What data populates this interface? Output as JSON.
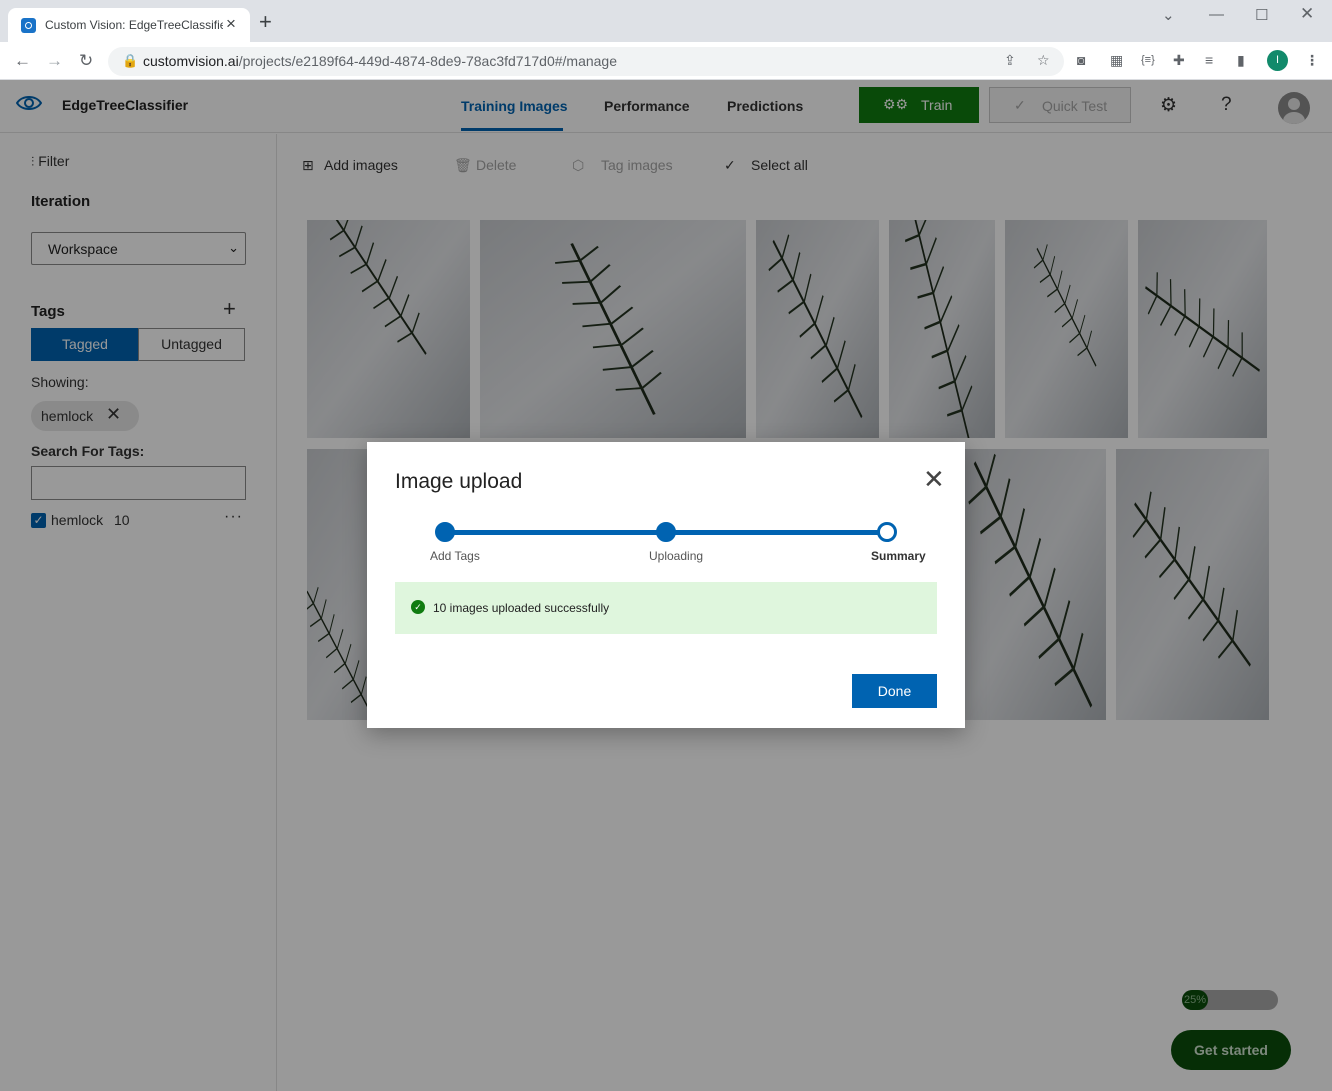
{
  "browser": {
    "tab_title": "Custom Vision: EdgeTreeClassifier",
    "url_host": "customvision.ai",
    "url_path": "/projects/e2189f64-449d-4874-8de9-78ac3fd717d0#/manage",
    "profile_initial": "I"
  },
  "header": {
    "project_name": "EdgeTreeClassifier",
    "tabs": [
      {
        "label": "Training Images",
        "active": true
      },
      {
        "label": "Performance",
        "active": false
      },
      {
        "label": "Predictions",
        "active": false
      }
    ],
    "train_label": "Train",
    "quick_test_label": "Quick Test",
    "settings_icon": "gear-icon",
    "help_label": "?"
  },
  "sidebar": {
    "filter_label": "Filter",
    "iteration_heading": "Iteration",
    "iteration_value": "Workspace",
    "tags_heading": "Tags",
    "toggle_tagged": "Tagged",
    "toggle_untagged": "Untagged",
    "showing_label": "Showing:",
    "showing_chip": "hemlock",
    "search_label": "Search For Tags:",
    "search_value": "",
    "tag_list": [
      {
        "name": "hemlock",
        "count": "10",
        "checked": true
      }
    ]
  },
  "commands": {
    "add_images": "Add images",
    "delete": "Delete",
    "tag_images": "Tag images",
    "select_all": "Select all"
  },
  "modal": {
    "title": "Image upload",
    "steps": [
      "Add Tags",
      "Uploading",
      "Summary"
    ],
    "current_step": 3,
    "success_message": "10 images uploaded successfully",
    "done_label": "Done"
  },
  "onboarding": {
    "progress": 0.25,
    "progress_label": "25%",
    "get_started_label": "Get started"
  },
  "colors": {
    "primary": "#0063b1",
    "train_green": "#107c10",
    "success_bg": "#dff6dd"
  }
}
